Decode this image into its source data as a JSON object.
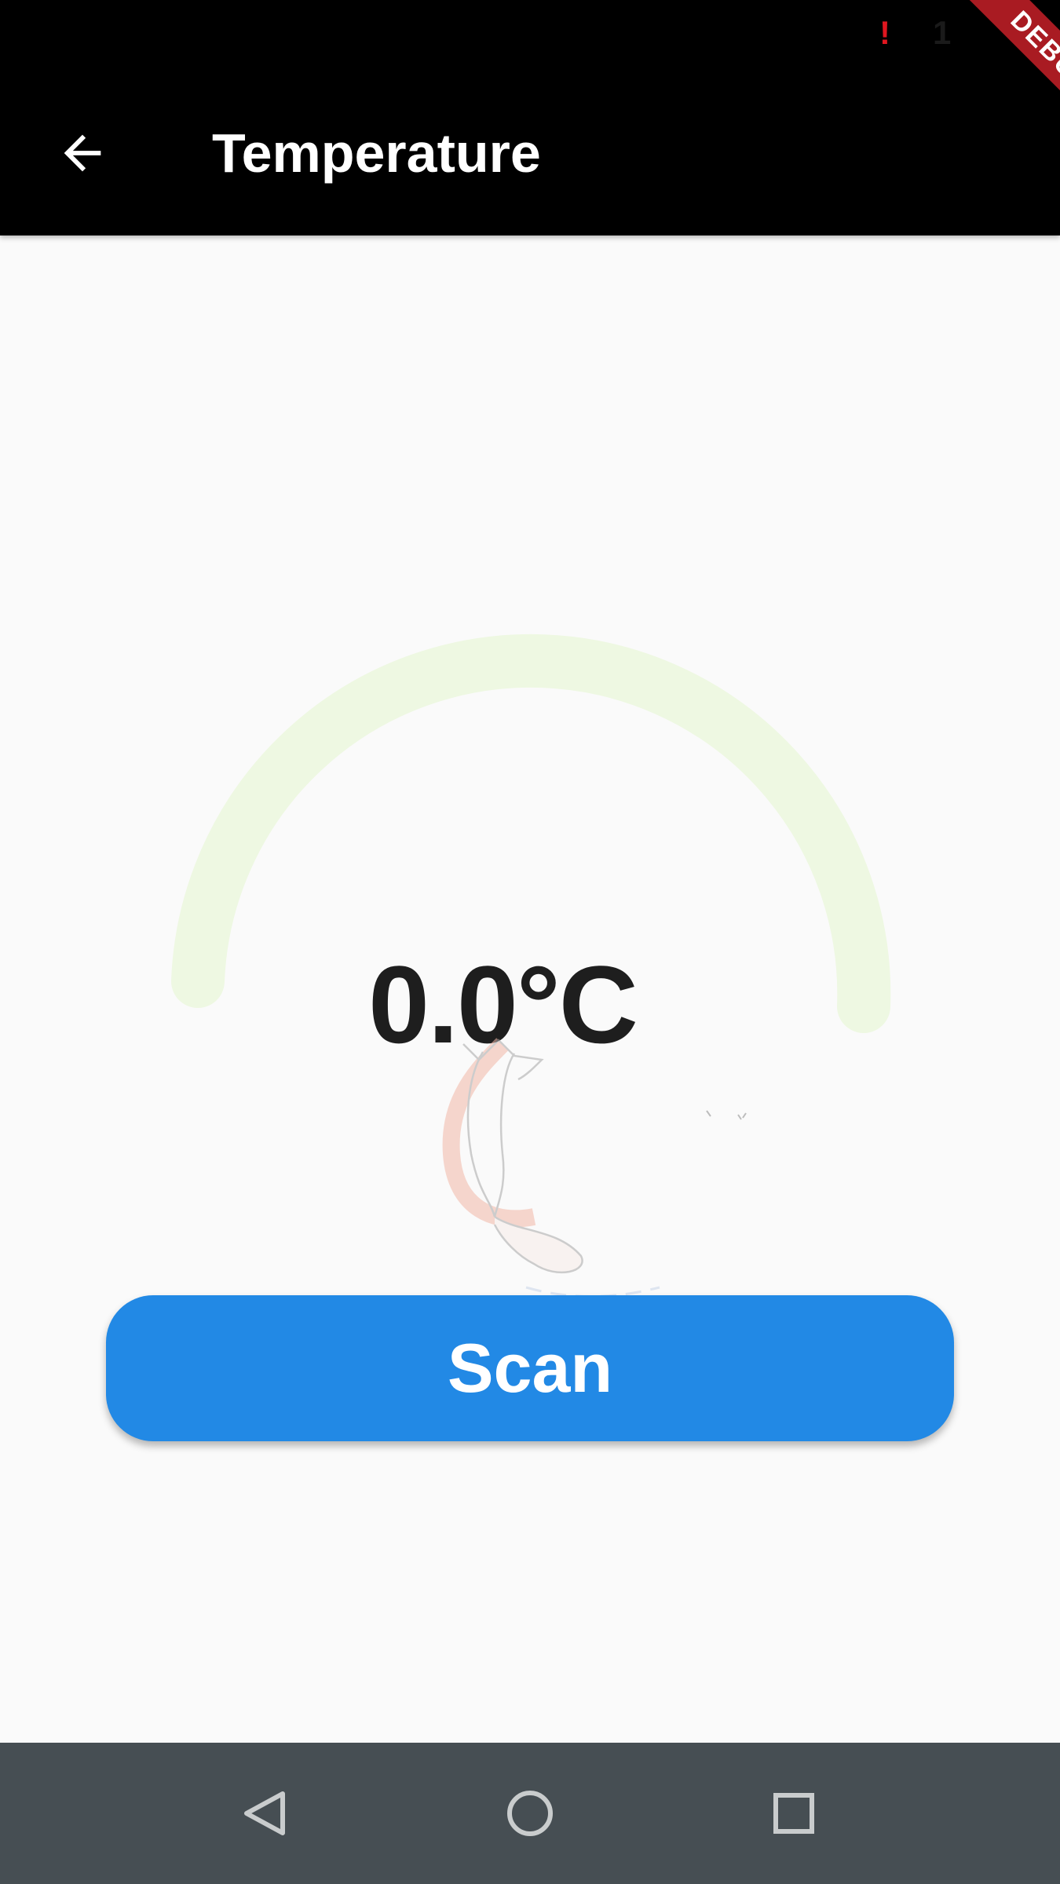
{
  "status_bar": {
    "alert": "!",
    "time": "1"
  },
  "debug_banner": {
    "label": "DEBUG",
    "color": "#a91b22"
  },
  "app_bar": {
    "title": "Temperature",
    "back_icon": "arrow-back-icon"
  },
  "gauge": {
    "value": 0.0,
    "readout": "0.0°C",
    "fill_fraction": 0,
    "track_color": "#eef8e2"
  },
  "scan_button": {
    "label": "Scan",
    "color": "#2289e5"
  },
  "nav_bar": {
    "back_icon": "triangle-back-icon",
    "home_icon": "circle-home-icon",
    "recents_icon": "square-recents-icon"
  }
}
